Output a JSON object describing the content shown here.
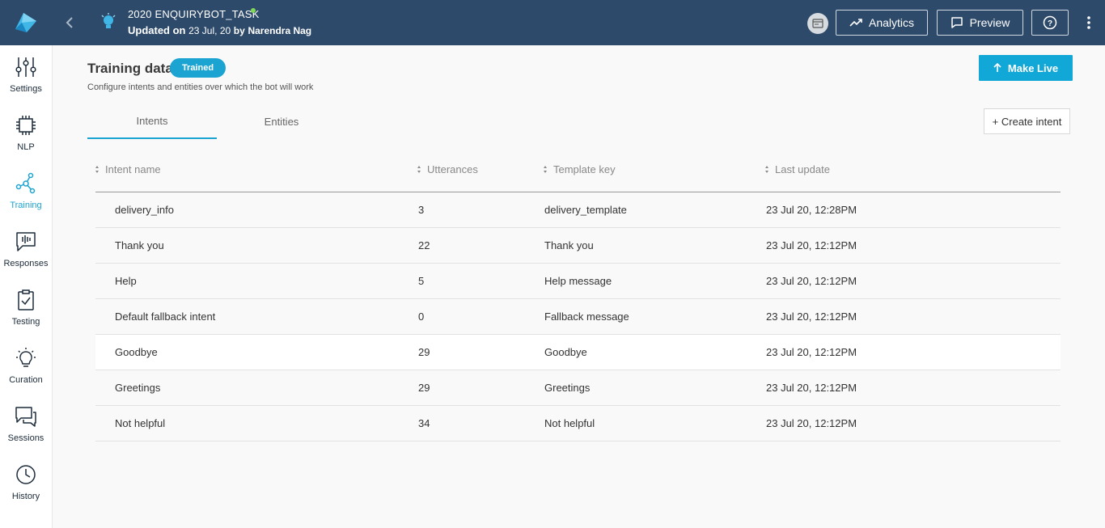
{
  "header": {
    "bot_title": "2020 ENQUIRYBOT_TASK",
    "updated_prefix": "Updated on",
    "updated_date": "23 Jul, 20",
    "updated_by_prefix": "by",
    "updated_by": "Narendra Nag",
    "analytics_label": "Analytics",
    "preview_label": "Preview",
    "help_label": "?"
  },
  "sidebar": {
    "items": [
      {
        "label": "Settings",
        "icon": "sliders-icon"
      },
      {
        "label": "NLP",
        "icon": "chip-icon"
      },
      {
        "label": "Training",
        "icon": "network-icon",
        "active": true
      },
      {
        "label": "Responses",
        "icon": "message-wave-icon"
      },
      {
        "label": "Testing",
        "icon": "clipboard-check-icon"
      },
      {
        "label": "Curation",
        "icon": "lightbulb-icon"
      },
      {
        "label": "Sessions",
        "icon": "chat-bubbles-icon"
      },
      {
        "label": "History",
        "icon": "clock-icon"
      }
    ]
  },
  "main": {
    "title": "Training data",
    "badge": "Trained",
    "description": "Configure intents and entities over which the bot will work",
    "make_live_label": "Make Live",
    "tabs": [
      {
        "label": "Intents",
        "active": true
      },
      {
        "label": "Entities",
        "active": false
      }
    ],
    "create_intent_label": "+ Create intent"
  },
  "table": {
    "columns": [
      "Intent name",
      "Utterances",
      "Template key",
      "Last update"
    ],
    "rows": [
      {
        "name": "delivery_info",
        "utterances": "3",
        "template": "delivery_template",
        "updated": "23 Jul 20, 12:28PM"
      },
      {
        "name": "Thank you",
        "utterances": "22",
        "template": "Thank you",
        "updated": "23 Jul 20, 12:12PM"
      },
      {
        "name": "Help",
        "utterances": "5",
        "template": "Help message",
        "updated": "23 Jul 20, 12:12PM"
      },
      {
        "name": "Default fallback intent",
        "utterances": "0",
        "template": "Fallback message",
        "updated": "23 Jul 20, 12:12PM"
      },
      {
        "name": "Goodbye",
        "utterances": "29",
        "template": "Goodbye",
        "updated": "23 Jul 20, 12:12PM"
      },
      {
        "name": "Greetings",
        "utterances": "29",
        "template": "Greetings",
        "updated": "23 Jul 20, 12:12PM"
      },
      {
        "name": "Not helpful",
        "utterances": "34",
        "template": "Not helpful",
        "updated": "23 Jul 20, 12:12PM"
      }
    ]
  },
  "colors": {
    "header_bg": "#2e4a6b",
    "accent": "#1ba4d1",
    "make_live_bg": "#11a7d6",
    "online": "#7ed957"
  }
}
